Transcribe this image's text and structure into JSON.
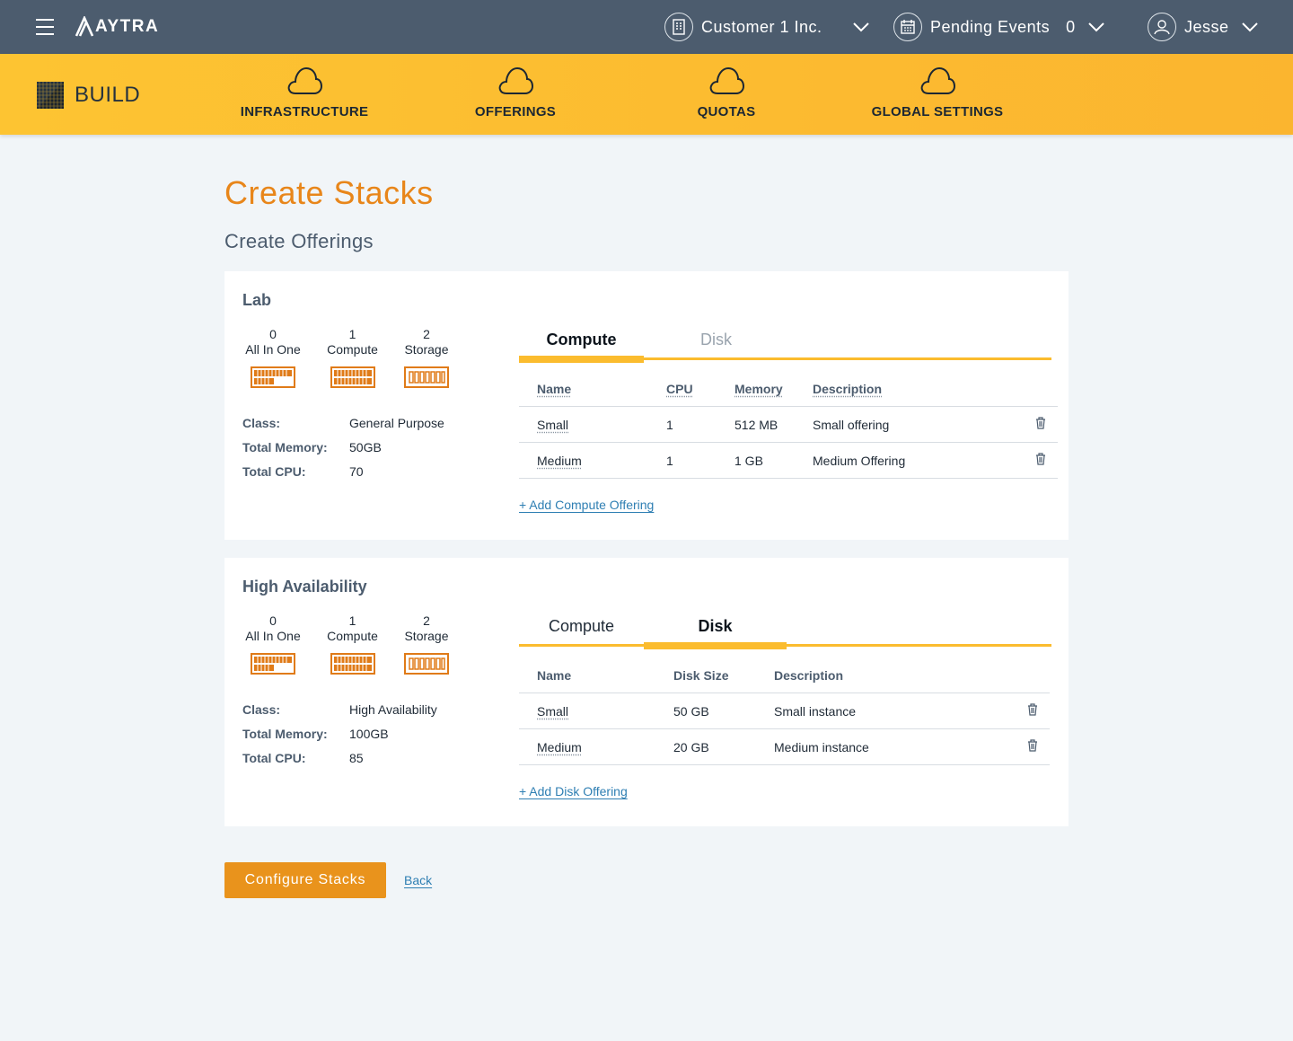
{
  "header": {
    "logo": "AYTRA",
    "account": "Customer 1 Inc.",
    "events_label": "Pending Events",
    "events_count": "0",
    "user": "Jesse"
  },
  "nav": {
    "section": "BUILD",
    "items": [
      {
        "label": "INFRASTRUCTURE",
        "icon": "cloud-icon"
      },
      {
        "label": "OFFERINGS",
        "icon": "cloud-icon"
      },
      {
        "label": "QUOTAS",
        "icon": "cloud-icon"
      },
      {
        "label": "GLOBAL SETTINGS",
        "icon": "cloud-icon"
      }
    ]
  },
  "page": {
    "title": "Create Stacks",
    "subtitle": "Create Offerings"
  },
  "stacks": [
    {
      "title": "Lab",
      "nodes": [
        {
          "count": "0",
          "label": "All In One"
        },
        {
          "count": "1",
          "label": "Compute"
        },
        {
          "count": "2",
          "label": "Storage"
        }
      ],
      "specs": [
        {
          "label": "Class:",
          "value": "General Purpose"
        },
        {
          "label": "Total Memory:",
          "value": "50GB"
        },
        {
          "label": "Total CPU:",
          "value": "70"
        }
      ],
      "tabs": [
        {
          "label": "Compute",
          "active": true
        },
        {
          "label": "Disk",
          "active": false
        }
      ],
      "table": {
        "columns": [
          "Name",
          "CPU",
          "Memory",
          "Description"
        ],
        "rows": [
          [
            "Small",
            "1",
            "512 MB",
            "Small offering"
          ],
          [
            "Medium",
            "1",
            "1 GB",
            "Medium Offering"
          ]
        ]
      },
      "add_link": "+ Add Compute Offering"
    },
    {
      "title": "High Availability",
      "nodes": [
        {
          "count": "0",
          "label": "All In One"
        },
        {
          "count": "1",
          "label": "Compute"
        },
        {
          "count": "2",
          "label": "Storage"
        }
      ],
      "specs": [
        {
          "label": "Class:",
          "value": "High Availability"
        },
        {
          "label": "Total Memory:",
          "value": "100GB"
        },
        {
          "label": "Total CPU:",
          "value": "85"
        }
      ],
      "tabs": [
        {
          "label": "Compute",
          "active": false
        },
        {
          "label": "Disk",
          "active": true
        }
      ],
      "table": {
        "columns": [
          "Name",
          "Disk Size",
          "Description"
        ],
        "rows": [
          [
            "Small",
            "50 GB",
            "Small instance"
          ],
          [
            "Medium",
            "20 GB",
            "Medium instance"
          ]
        ]
      },
      "add_link": "+ Add Disk Offering"
    }
  ],
  "actions": {
    "primary": "Configure Stacks",
    "back": "Back"
  },
  "colors": {
    "topbar": "#4c5c6e",
    "nav": "#fdc432",
    "accent": "#e8861a",
    "link": "#2f7fb3"
  }
}
